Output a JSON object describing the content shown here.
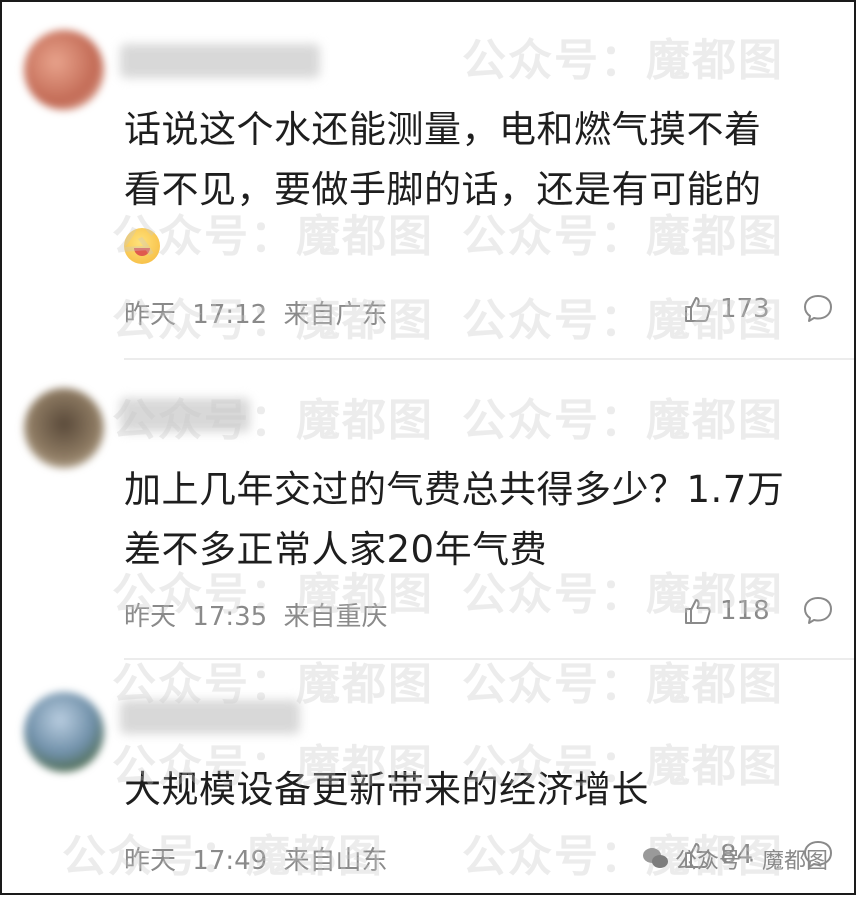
{
  "comments": [
    {
      "text_lines": [
        "话说这个水还能测量，电和燃气摸不着",
        "看不见，要做手脚的话，还是有可能的"
      ],
      "emoji": "drooling-face-emoji",
      "date": "昨天",
      "time": "17:12",
      "location": "来自广东",
      "likes": "173"
    },
    {
      "text_lines": [
        "加上几年交过的气费总共得多少？1.7万",
        "差不多正常人家20年气费"
      ],
      "date": "昨天",
      "time": "17:35",
      "location": "来自重庆",
      "likes": "118"
    },
    {
      "text_lines": [
        "大规模设备更新带来的经济增长"
      ],
      "date": "昨天",
      "time": "17:49",
      "location": "来自山东",
      "likes": "84"
    }
  ],
  "watermark": "公众号：魔都图",
  "footer_watermark": "公众号 · 魔都图",
  "colors": {
    "text": "#1e1e1e",
    "meta": "#8a8a8a",
    "divider": "#ececec",
    "border": "#1a1a1a"
  },
  "icons": [
    "thumbs-up-icon",
    "comment-bubble-icon",
    "wechat-icon"
  ]
}
